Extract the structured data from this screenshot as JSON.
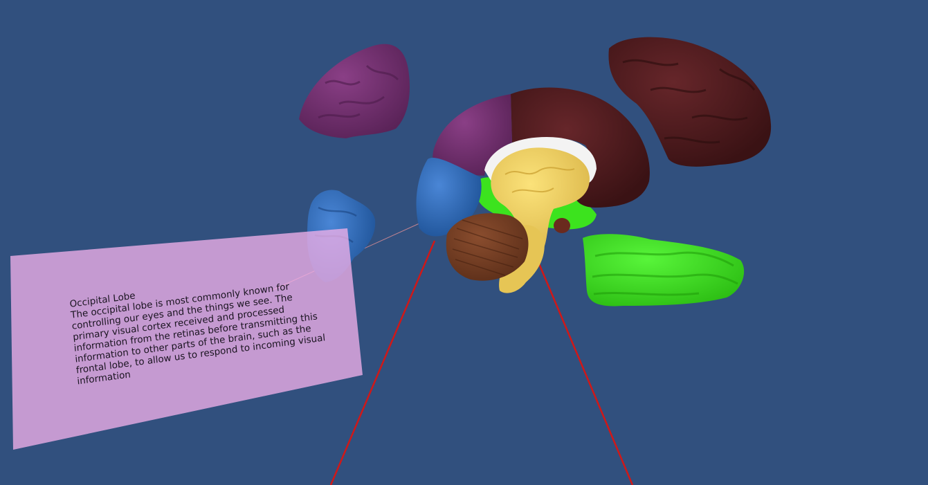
{
  "info_panel": {
    "title": "Occipital Lobe",
    "body": "The occipital lobe is most commonly known for controlling our eyes and the things we see. The primary visual cortex received and processed information from the retinas before transmitting this information to other parts of the brain, such as the frontal lobe, to allow us to respond to incoming visual information"
  },
  "colors": {
    "background": "#31507e",
    "parietal_lobe": "#6e2f6c",
    "frontal_lobe": "#4a1a1a",
    "occipital_lobe": "#2f6dbf",
    "temporal_lobe": "#3ee01f",
    "limbic_system": "#f0d060",
    "cerebellum": "#6a3a22",
    "panel": "#e6a8e0",
    "laser": "#d01818"
  }
}
